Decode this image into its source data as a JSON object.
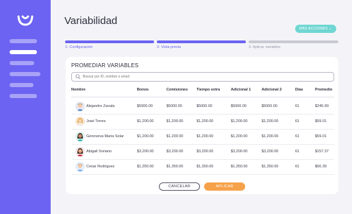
{
  "header": {
    "title": "Variabilidad",
    "more_actions": "MÁS ACCIONES ⌄"
  },
  "steps": [
    {
      "label": "1- Configuración",
      "state": "done"
    },
    {
      "label": "2- Vista previa",
      "state": "done"
    },
    {
      "label": "3- Aplicar variables",
      "state": "todo"
    }
  ],
  "card": {
    "title": "PROMEDIAR VARIABLES",
    "search_placeholder": "Buscar por ID, nombre o email"
  },
  "table": {
    "columns": [
      "Nombre",
      "Bonos",
      "Comisiones",
      "Tiempo extra",
      "Adicional 1",
      "Adicional 2",
      "Días",
      "Promedio"
    ],
    "rows": [
      {
        "name": "Alejandro Zavala",
        "bonos": "$5000.00",
        "comisiones": "$5000.00",
        "tiempo_extra": "$5000.00",
        "adicional1": "$5000.00",
        "adicional2": "$5000.00",
        "dias": "61",
        "promedio": "$245.90",
        "avatar": "man-avatar"
      },
      {
        "name": "José Torres",
        "bonos": "$1,200.00",
        "comisiones": "$1,200.00",
        "tiempo_extra": "$1,200.00",
        "adicional1": "$1,200.00",
        "adicional2": "$1,200.00",
        "dias": "61",
        "promedio": "$59.01",
        "avatar": "woman-avatar"
      },
      {
        "name": "Genoveva Maria Solar",
        "bonos": "$1,200.00",
        "comisiones": "$1,200.00",
        "tiempo_extra": "$1,200.00",
        "adicional1": "$1,200.00",
        "adicional2": "$1,200.00",
        "dias": "61",
        "promedio": "$59.01",
        "avatar": "woman-avatar"
      },
      {
        "name": "Abigail Soriano",
        "bonos": "$3,200.00",
        "comisiones": "$3,200.00",
        "tiempo_extra": "$3,200.00",
        "adicional1": "$3,200.00",
        "adicional2": "$3,200.00",
        "dias": "61",
        "promedio": "$157.37",
        "avatar": "woman-avatar"
      },
      {
        "name": "Cesar Rodriguez",
        "bonos": "$1,350.00",
        "comisiones": "$1,350.00",
        "tiempo_extra": "$1,350.00",
        "adicional1": "$1,350.00",
        "adicional2": "$1,350.00",
        "dias": "61",
        "promedio": "$66.39",
        "avatar": "man-avatar"
      }
    ]
  },
  "actions": {
    "cancel": "CANCELAR",
    "apply": "APLICAR"
  },
  "colors": {
    "primary": "#6c63f2",
    "teal": "#6fd6d2",
    "orange": "#f6a24b"
  }
}
